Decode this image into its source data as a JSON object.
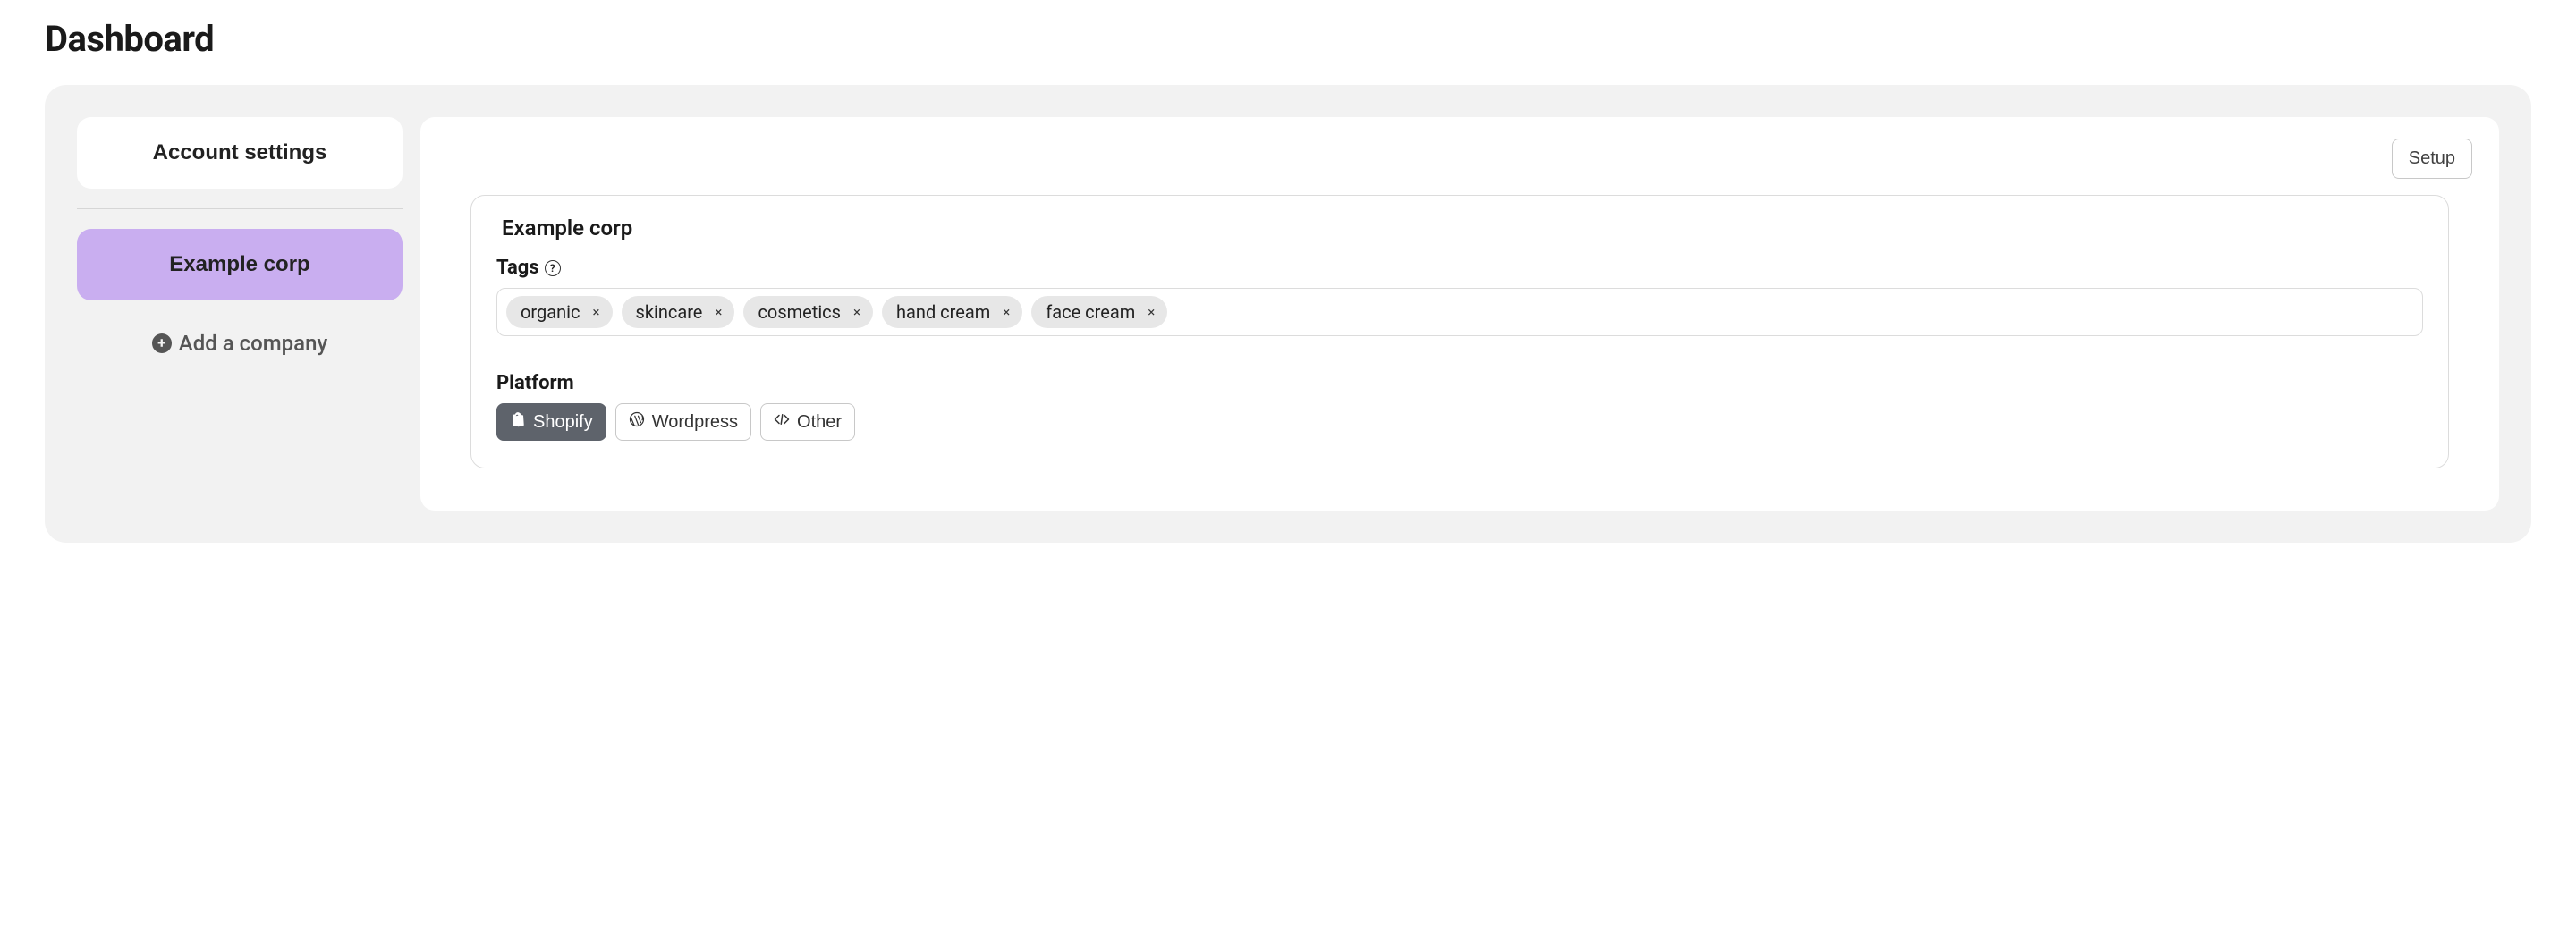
{
  "page": {
    "title": "Dashboard"
  },
  "sidebar": {
    "account_settings": "Account settings",
    "company_item": "Example corp",
    "add_company": "Add a company"
  },
  "main": {
    "setup_button": "Setup",
    "card": {
      "title": "Example corp",
      "tags_label": "Tags",
      "tags": [
        "organic",
        "skincare",
        "cosmetics",
        "hand cream",
        "face cream"
      ],
      "platform_label": "Platform",
      "platforms": [
        {
          "name": "Shopify",
          "icon": "shopify-icon",
          "selected": true
        },
        {
          "name": "Wordpress",
          "icon": "wordpress-icon",
          "selected": false
        },
        {
          "name": "Other",
          "icon": "code-icon",
          "selected": false
        }
      ]
    }
  }
}
